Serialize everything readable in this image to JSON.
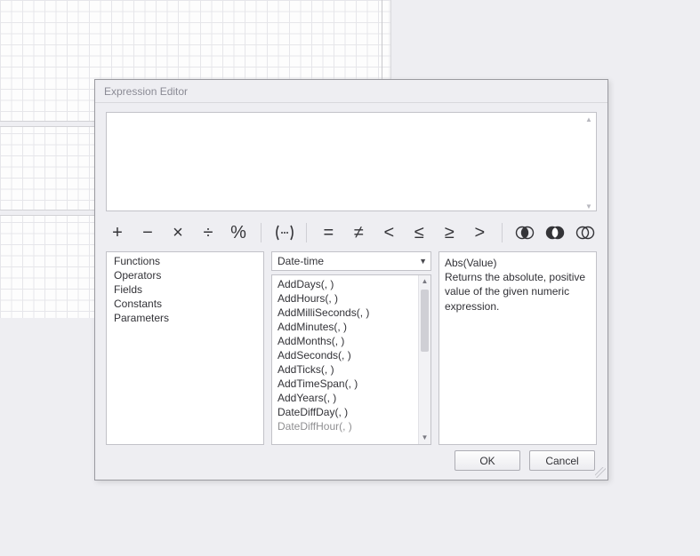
{
  "dialog": {
    "title": "Expression Editor",
    "expression_value": "",
    "ok_label": "OK",
    "cancel_label": "Cancel"
  },
  "operators": {
    "plus": "+",
    "minus": "−",
    "multiply": "×",
    "divide": "÷",
    "modulo": "%",
    "group": "(∙∙∙)",
    "equal": "=",
    "notequal": "≠",
    "lt": "<",
    "lte": "≤",
    "gte": "≥",
    "gt": ">",
    "and": "◎",
    "or": "◎",
    "not": "◎"
  },
  "categories": {
    "items": [
      {
        "label": "Functions"
      },
      {
        "label": "Operators"
      },
      {
        "label": "Fields"
      },
      {
        "label": "Constants"
      },
      {
        "label": "Parameters"
      }
    ]
  },
  "subcategory": {
    "selected": "Date-time"
  },
  "functions": {
    "items": [
      {
        "label": "AddDays(, )"
      },
      {
        "label": "AddHours(, )"
      },
      {
        "label": "AddMilliSeconds(, )"
      },
      {
        "label": "AddMinutes(, )"
      },
      {
        "label": "AddMonths(, )"
      },
      {
        "label": "AddSeconds(, )"
      },
      {
        "label": "AddTicks(, )"
      },
      {
        "label": "AddTimeSpan(, )"
      },
      {
        "label": "AddYears(, )"
      },
      {
        "label": "DateDiffDay(, )"
      },
      {
        "label": "DateDiffHour(, )"
      }
    ]
  },
  "description": {
    "signature": "Abs(Value)",
    "text": "Returns the absolute, positive value of the given numeric expression."
  }
}
